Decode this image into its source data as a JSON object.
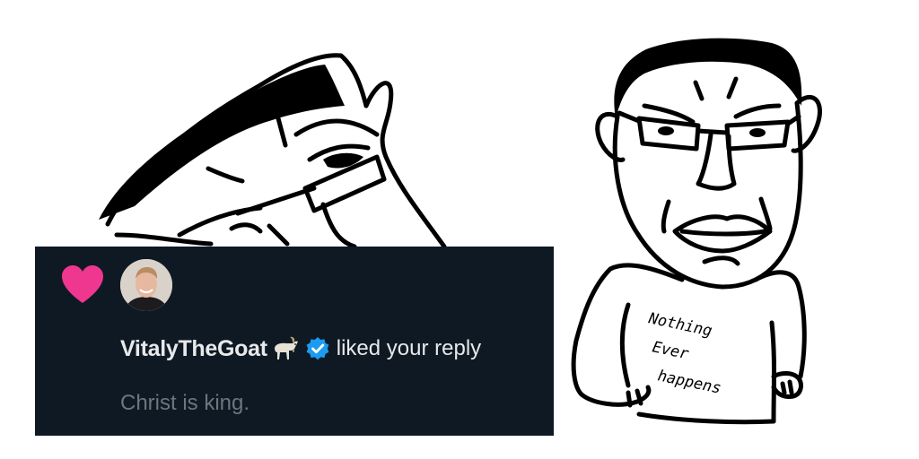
{
  "notification": {
    "type_icon": "heart-icon",
    "avatar_icon": "user-avatar",
    "user_name": "VitalyTheGoat",
    "name_emoji_icon": "goat-icon",
    "verified_icon": "verified-badge-icon",
    "action_text": "liked your reply",
    "tweet_text": "Christ is king."
  },
  "illustration": {
    "shirt_lines": [
      "Nothing",
      "Ever",
      "happens"
    ]
  },
  "colors": {
    "card_background": "#0f1924",
    "heart": "#f0378f",
    "verified": "#1d9bf0",
    "primary_text": "#e7e9ea",
    "secondary_text": "#6e767d"
  }
}
